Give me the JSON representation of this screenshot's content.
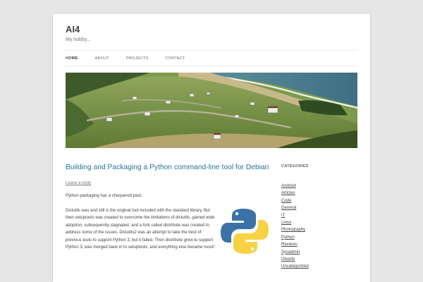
{
  "site": {
    "title": "AI4",
    "tagline": "My hobby..."
  },
  "nav": {
    "items": [
      "HOME",
      "ABOUT",
      "PROJECTS",
      "CONTACT"
    ],
    "active": "HOME"
  },
  "post": {
    "title": "Building and Packaging a Python command-line tool for Debian",
    "reply_link": "Leave a reply",
    "paragraph1": "Python packaging has a chequered past.",
    "paragraph2": "Distutils was and still is the original tool included with the standard library. But then setuptools was created to overcome the limitations of distutils, gained wide adoption, subsequently stagnated, and a fork called distribute was created to address some of the issues. Distutils2 was an attempt to take the best of previous tools to support Python 3, but it failed. Then distribute grew to support Python 3, was merged back in to setuptools, and everything else became moot!"
  },
  "sidebar": {
    "heading": "CATEGORIES",
    "categories": [
      "Android",
      "Articles",
      "Code",
      "General",
      "IT",
      "Linux",
      "Photography",
      "Python",
      "Reviews",
      "Sysadmin",
      "Ubuntu",
      "Uncategorized"
    ]
  },
  "colors": {
    "link_blue": "#21759b",
    "python_blue": "#3a72a8",
    "python_yellow": "#f7d244",
    "background": "#e6e6e6"
  }
}
